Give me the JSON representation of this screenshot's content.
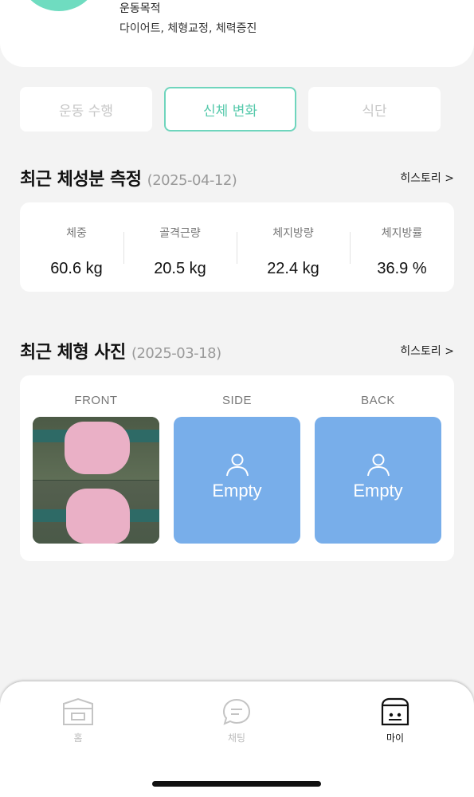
{
  "profile": {
    "goal_label": "운동목적",
    "goal_value": "다이어트, 체형교정, 체력증진"
  },
  "tabs": [
    {
      "label": "운동 수행",
      "active": false
    },
    {
      "label": "신체 변화",
      "active": true
    },
    {
      "label": "식단",
      "active": false
    }
  ],
  "body_composition": {
    "title": "최근 체성분 측정",
    "date": "(2025-04-12)",
    "history_label": "히스토리 >",
    "stats": [
      {
        "label": "체중",
        "value": "60.6 kg"
      },
      {
        "label": "골격근량",
        "value": "20.5 kg"
      },
      {
        "label": "체지방량",
        "value": "22.4 kg"
      },
      {
        "label": "체지방률",
        "value": "36.9 %"
      }
    ]
  },
  "body_photos": {
    "title": "최근 체형 사진",
    "date": "(2025-03-18)",
    "history_label": "히스토리 >",
    "photos": [
      {
        "label": "FRONT",
        "status": "photo"
      },
      {
        "label": "SIDE",
        "status": "Empty"
      },
      {
        "label": "BACK",
        "status": "Empty"
      }
    ]
  },
  "nav": {
    "items": [
      {
        "label": "홈",
        "icon": "home-icon",
        "active": false
      },
      {
        "label": "채팅",
        "icon": "chat-icon",
        "active": false
      },
      {
        "label": "마이",
        "icon": "my-icon",
        "active": true
      }
    ]
  },
  "colors": {
    "accent": "#55c9ab",
    "empty_photo": "#78aeea",
    "background": "#f3f3f3"
  }
}
